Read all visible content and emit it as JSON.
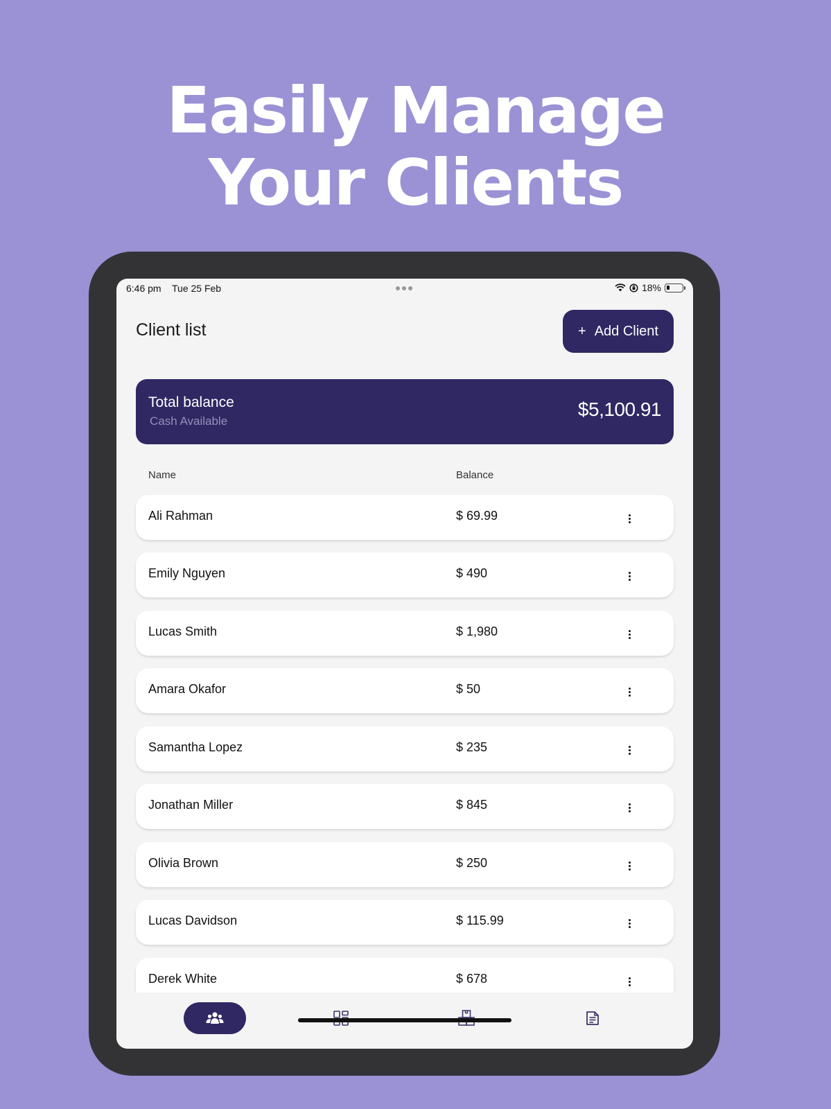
{
  "headline": {
    "line1": "Easily Manage",
    "line2": "Your Clients"
  },
  "status_bar": {
    "time": "6:46 pm",
    "date": "Tue 25 Feb",
    "battery": "18%"
  },
  "header": {
    "title": "Client list",
    "add_button": "Add Client",
    "add_icon": "+"
  },
  "balance": {
    "title": "Total balance",
    "subtitle": "Cash Available",
    "amount": "$5,100.91"
  },
  "table": {
    "columns": [
      "Name",
      "Balance"
    ],
    "rows": [
      {
        "name": "Ali Rahman",
        "balance": "$ 69.99"
      },
      {
        "name": "Emily Nguyen",
        "balance": "$ 490"
      },
      {
        "name": "Lucas Smith",
        "balance": "$ 1,980"
      },
      {
        "name": "Amara Okafor",
        "balance": "$ 50"
      },
      {
        "name": "Samantha Lopez",
        "balance": "$ 235"
      },
      {
        "name": "Jonathan Miller",
        "balance": "$ 845"
      },
      {
        "name": "Olivia Brown",
        "balance": "$ 250"
      },
      {
        "name": "Lucas Davidson",
        "balance": "$ 115.99"
      },
      {
        "name": "Derek White",
        "balance": "$ 678"
      }
    ]
  },
  "nav": {
    "items": [
      {
        "icon": "clients-icon",
        "active": true
      },
      {
        "icon": "dashboard-icon",
        "active": false
      },
      {
        "icon": "inventory-icon",
        "active": false
      },
      {
        "icon": "reports-icon",
        "active": false
      }
    ]
  },
  "colors": {
    "background": "#9a92d5",
    "accent": "#2f2863",
    "screen": "#f4f4f4",
    "device": "#333335"
  }
}
